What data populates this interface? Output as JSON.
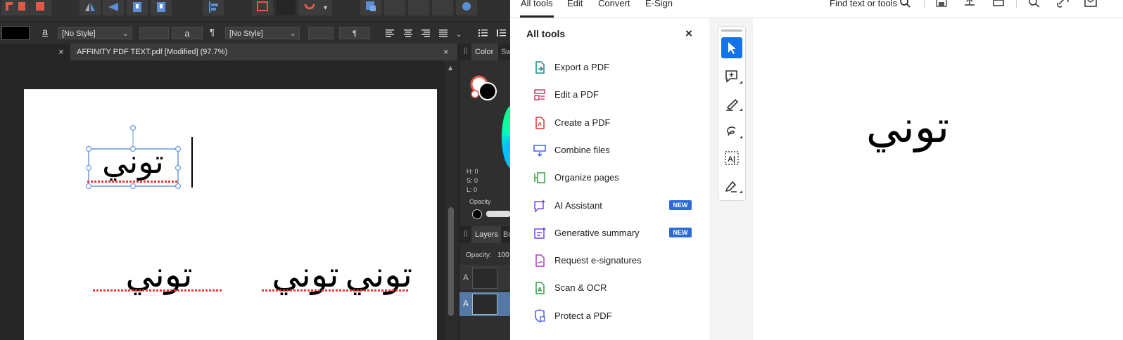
{
  "affinity": {
    "style_left": "[No Style]",
    "style_right": "[No Style]",
    "char_a1": "a",
    "char_a2": "a",
    "pilcrow1": "¶",
    "pilcrow2": "¶",
    "doc_tab_title": "AFFINITY PDF TEXT.pdf [Modified] (97.7%)",
    "close_glyph": "×",
    "color_tab": "Color",
    "swatch_tab": "Sw",
    "hsl": {
      "h": "H: 0",
      "s": "S: 0",
      "l": "L: 0"
    },
    "opacity_label": "Opacity",
    "layers_tab": "Layers",
    "brushes_tab": "Br",
    "layers_opacity": "Opacity:",
    "layers_opacity_val": "100",
    "layer_a1": "A",
    "layer_a2": "A",
    "canvas_text_1": "توني",
    "canvas_text_2": "توني",
    "canvas_text_3": "توني",
    "canvas_text_4": "توني"
  },
  "acrobat": {
    "menu": [
      "All tools",
      "Edit",
      "Convert",
      "E-Sign"
    ],
    "search_label": "Find text or tools",
    "panel_title": "All tools",
    "close_glyph": "×",
    "tools": [
      {
        "label": "Export a PDF",
        "icon": "export-pdf-icon",
        "color": "#1a8a8a"
      },
      {
        "label": "Edit a PDF",
        "icon": "edit-pdf-icon",
        "color": "#d6336c"
      },
      {
        "label": "Create a PDF",
        "icon": "create-pdf-icon",
        "color": "#e03131"
      },
      {
        "label": "Combine files",
        "icon": "combine-files-icon",
        "color": "#4263eb"
      },
      {
        "label": "Organize pages",
        "icon": "organize-pages-icon",
        "color": "#2f9e44"
      },
      {
        "label": "AI Assistant",
        "icon": "ai-assistant-icon",
        "color": "#7048e8",
        "badge": "NEW"
      },
      {
        "label": "Generative summary",
        "icon": "generative-summary-icon",
        "color": "#7048e8",
        "badge": "NEW"
      },
      {
        "label": "Request e-signatures",
        "icon": "request-esign-icon",
        "color": "#ae3ec9"
      },
      {
        "label": "Scan & OCR",
        "icon": "scan-ocr-icon",
        "color": "#2f9e44"
      },
      {
        "label": "Protect a PDF",
        "icon": "protect-pdf-icon",
        "color": "#4263eb"
      }
    ],
    "pdf_text": "توني",
    "accent": "#1473e6"
  }
}
